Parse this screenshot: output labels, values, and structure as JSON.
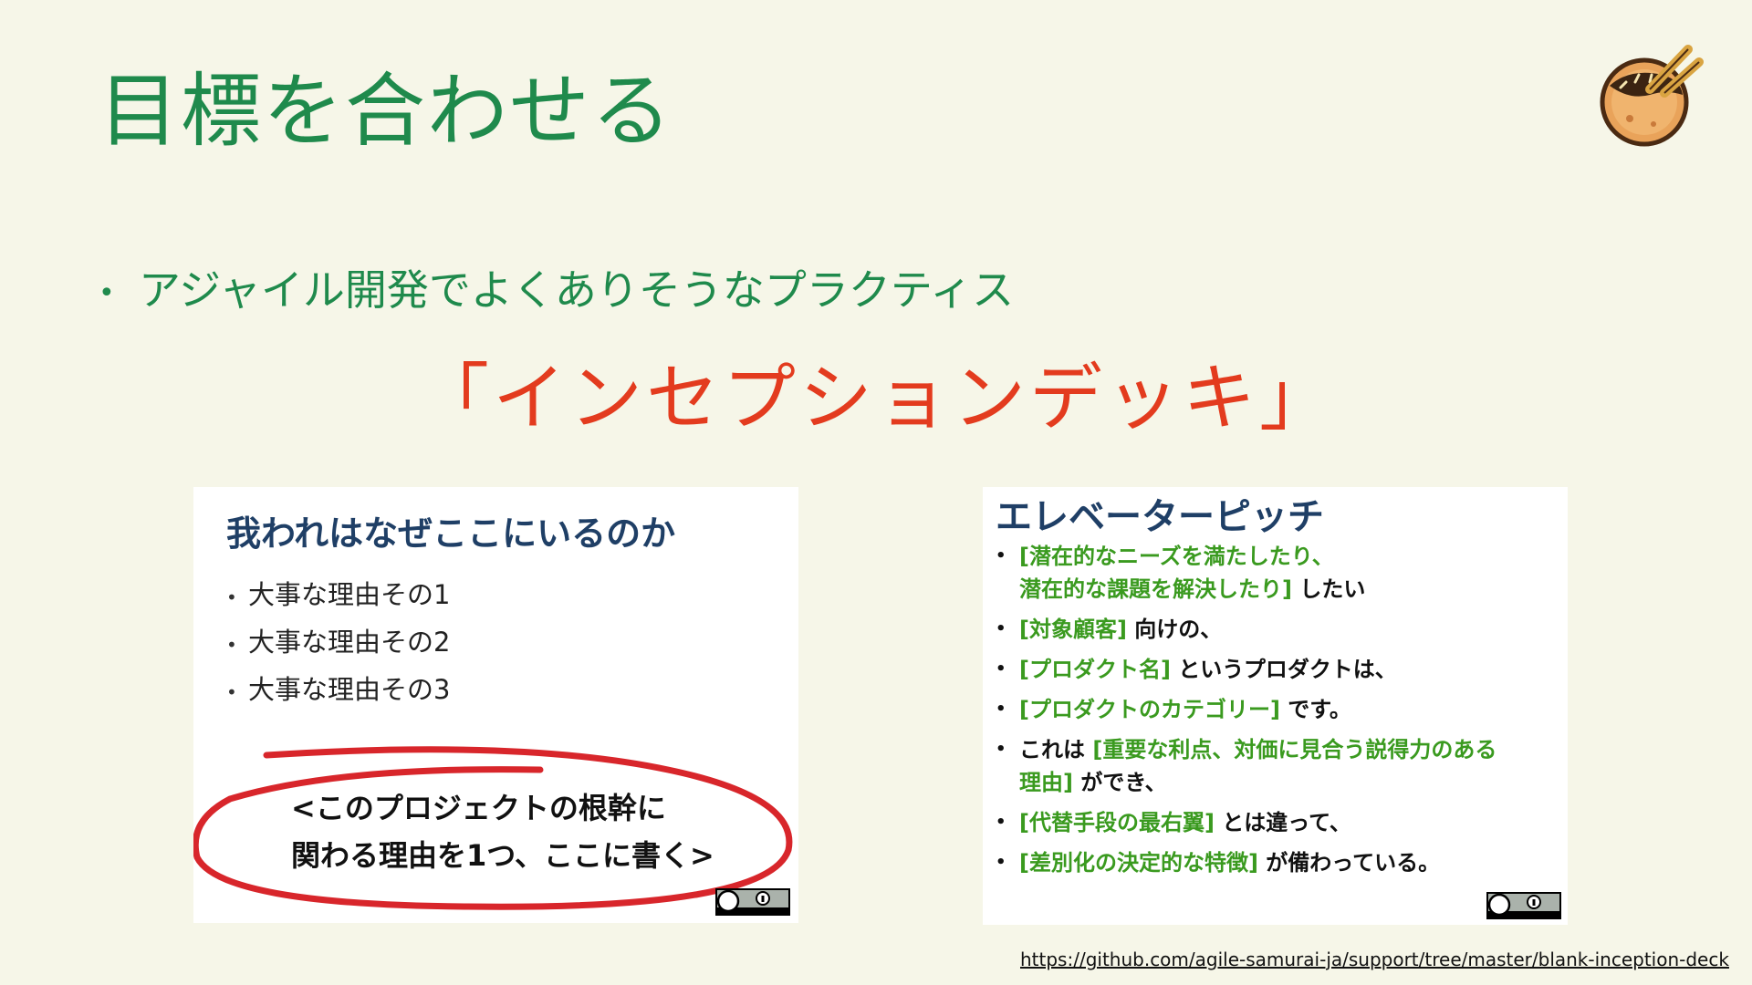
{
  "slide": {
    "title": "目標を合わせる",
    "bullet": "アジャイル開発でよくありそうなプラクティス",
    "headline": "「インセプションデッキ」"
  },
  "left_card": {
    "title": "我われはなぜここにいるのか",
    "items": [
      "大事な理由その1",
      "大事な理由その2",
      "大事な理由その3"
    ],
    "statement_line1": "<このプロジェクトの根幹に",
    "statement_line2": "関わる理由を1つ、ここに書く>",
    "cc_badge": "cc-by-badge",
    "ellipse_color": "#d8262b"
  },
  "right_card": {
    "title": "エレベーターピッチ",
    "items": [
      {
        "green": "[潜在的なニーズを満たしたり、",
        "green2": "潜在的な課題を解決したり]",
        "black": " したい"
      },
      {
        "green": "[対象顧客]",
        "black": " 向けの、"
      },
      {
        "green": "[プロダクト名]",
        "black": " というプロダクトは、"
      },
      {
        "green": "[プロダクトのカテゴリー]",
        "black": " です。"
      },
      {
        "pre": "これは ",
        "green": "[重要な利点、対価に見合う説得力のある",
        "green2": "理由]",
        "black": " ができ、"
      },
      {
        "green": "[代替手段の最右翼]",
        "black": " とは違って、"
      },
      {
        "green": "[差別化の決定的な特徴]",
        "black": " が備わっている。"
      }
    ],
    "cc_badge": "cc-by-badge"
  },
  "source_url": "https://github.com/agile-samurai-ja/support/tree/master/blank-inception-deck",
  "logo": "takoyaki-mascot-icon",
  "colors": {
    "background": "#f6f6e8",
    "title_green": "#1f8a4c",
    "headline_red": "#e33b1e",
    "card_title_navy": "#1f3f66",
    "highlight_green": "#3a9a1f"
  }
}
